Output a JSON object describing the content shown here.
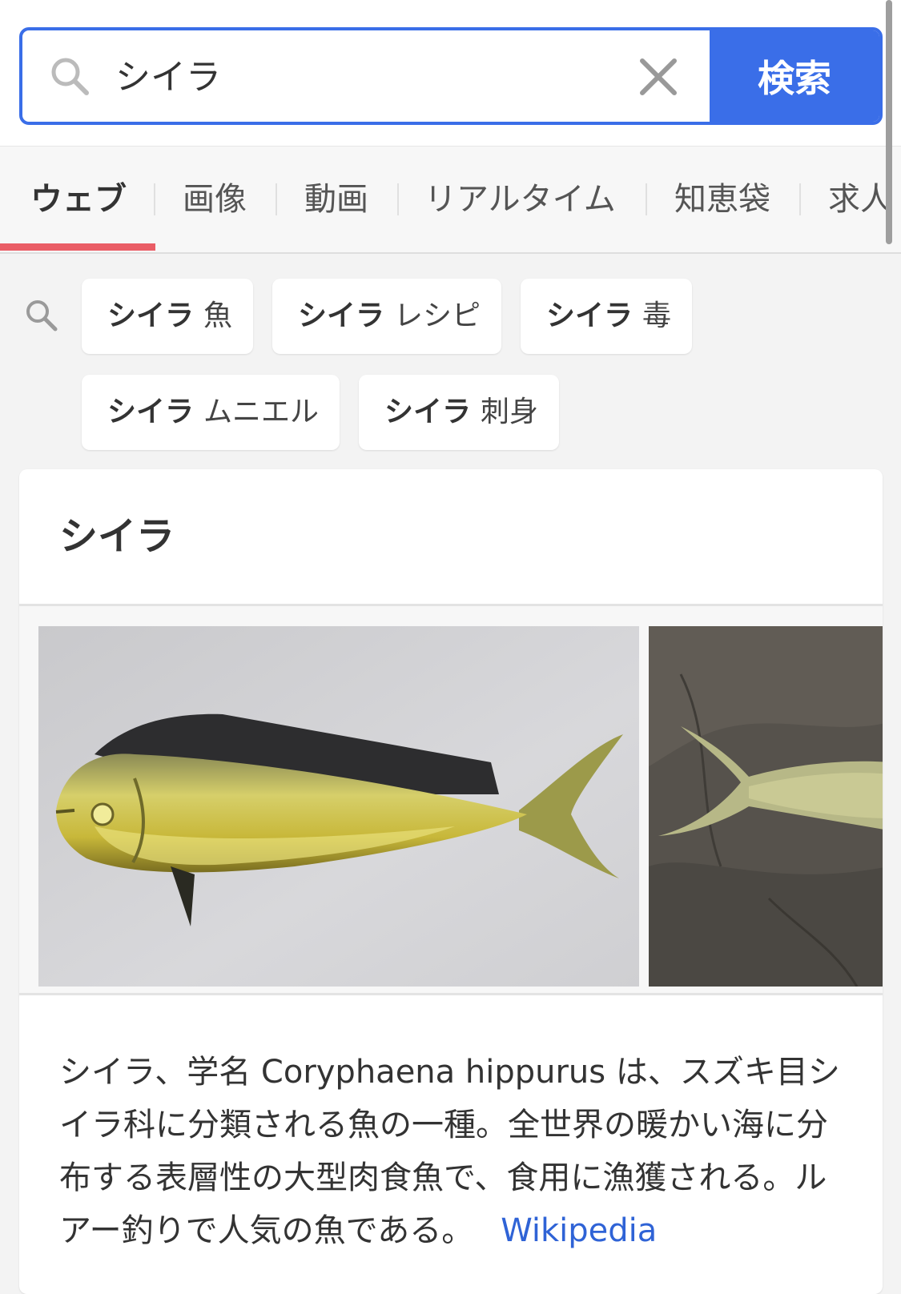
{
  "search": {
    "query": "シイラ",
    "button_label": "検索"
  },
  "tabs": [
    {
      "label": "ウェブ",
      "active": true
    },
    {
      "label": "画像",
      "active": false
    },
    {
      "label": "動画",
      "active": false
    },
    {
      "label": "リアルタイム",
      "active": false
    },
    {
      "label": "知恵袋",
      "active": false
    },
    {
      "label": "求人",
      "active": false
    }
  ],
  "suggestions": [
    {
      "bold": "シイラ",
      "rest": "魚"
    },
    {
      "bold": "シイラ",
      "rest": "レシピ"
    },
    {
      "bold": "シイラ",
      "rest": "毒"
    },
    {
      "bold": "シイラ",
      "rest": "ムニエル"
    },
    {
      "bold": "シイラ",
      "rest": "刺身"
    }
  ],
  "knowledge": {
    "title": "シイラ",
    "description": "シイラ、学名 Coryphaena hippurus は、スズキ目シイラ科に分類される魚の一種。全世界の暖かい海に分布する表層性の大型肉食魚で、食用に漁獲される。ルアー釣りで人気の魚である。",
    "source_link": "Wikipedia"
  },
  "colors": {
    "accent": "#3a6ee8",
    "tab_underline": "#ea5d66",
    "link": "#2f63d6"
  },
  "icons": [
    "search-icon",
    "clear-icon",
    "suggest-search-icon"
  ]
}
